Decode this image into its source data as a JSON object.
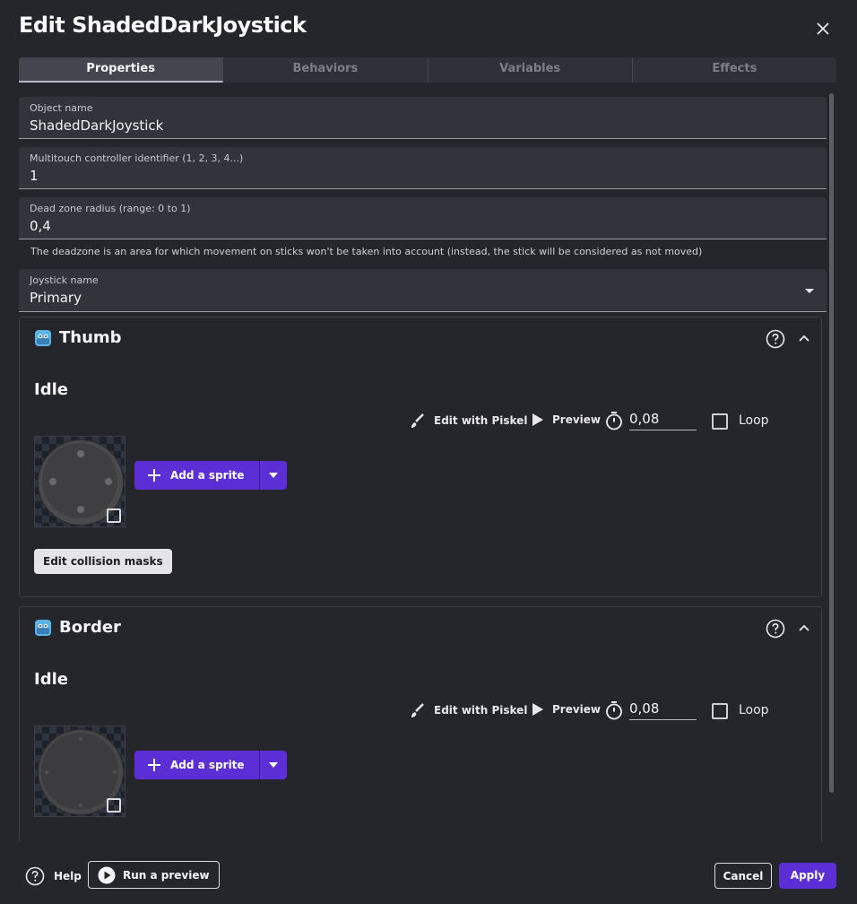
{
  "dialog": {
    "title": "Edit ShadedDarkJoystick"
  },
  "tabs": [
    {
      "label": "Properties",
      "active": true
    },
    {
      "label": "Behaviors"
    },
    {
      "label": "Variables"
    },
    {
      "label": "Effects"
    }
  ],
  "fields": {
    "object_name": {
      "label": "Object name",
      "value": "ShadedDarkJoystick"
    },
    "multitouch_id": {
      "label": "Multitouch controller identifier (1, 2, 3, 4...)",
      "value": "1"
    },
    "dead_zone": {
      "label": "Dead zone radius (range: 0 to 1)",
      "value": "0,4",
      "helper": "The deadzone is an area for which movement on sticks won't be taken into account (instead, the stick will be considered as not moved)"
    },
    "joystick_name": {
      "label": "Joystick name",
      "value": "Primary"
    }
  },
  "sections": [
    {
      "title": "Thumb",
      "animation": "Idle",
      "edit_label": "Edit with Piskel",
      "preview_label": "Preview",
      "timer_value": "0,08",
      "loop_label": "Loop",
      "add_sprite_label": "Add a sprite",
      "collision_label": "Edit collision masks"
    },
    {
      "title": "Border",
      "animation": "Idle",
      "edit_label": "Edit with Piskel",
      "preview_label": "Preview",
      "timer_value": "0,08",
      "loop_label": "Loop",
      "add_sprite_label": "Add a sprite"
    }
  ],
  "footer": {
    "help_label": "Help",
    "run_preview_label": "Run a preview",
    "cancel_label": "Cancel",
    "apply_label": "Apply"
  },
  "colors": {
    "accent": "#5c2fd6",
    "background": "#25262c",
    "field": "#32333b"
  }
}
